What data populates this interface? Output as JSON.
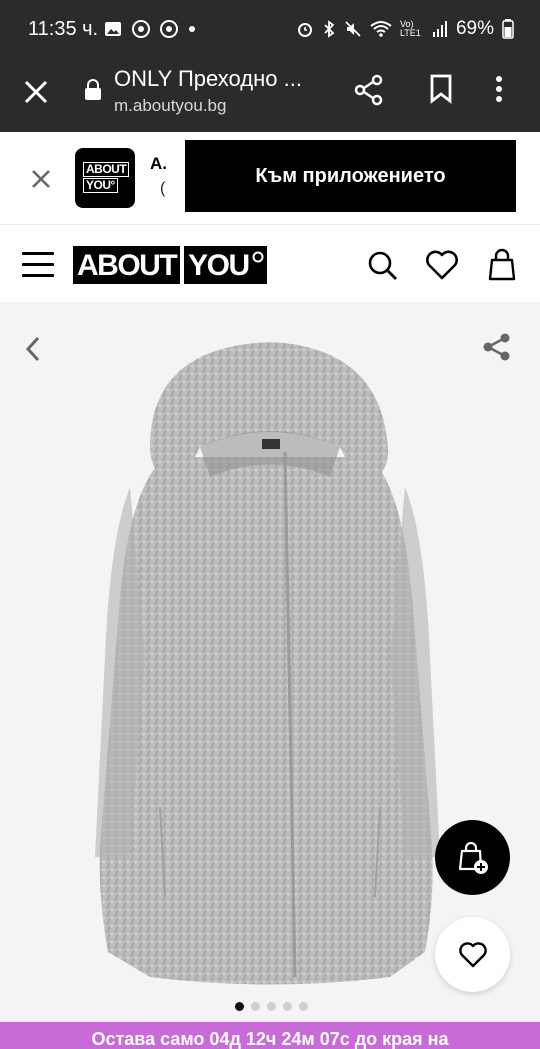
{
  "status_bar": {
    "time": "11:35 ч.",
    "battery": "69%",
    "network_label": "Vo) LTE1"
  },
  "browser": {
    "page_title": "ONLY Преходно ...",
    "domain": "m.aboutyou.bg"
  },
  "app_banner": {
    "logo_lines": [
      "ABOUT",
      "YOU°"
    ],
    "app_name": "A.",
    "app_sub": "(",
    "cta_label": "Към приложението"
  },
  "site_header": {
    "logo_left": "ABOUT",
    "logo_right": "YOU"
  },
  "product": {
    "image_alt": "ONLY grey wool coat with hood",
    "carousel": {
      "total": 5,
      "active": 1
    }
  },
  "promo": {
    "text": "Остава само 04д 12ч 24м 07с до края на"
  },
  "colors": {
    "browser_bar": "#2b2b2b",
    "promo": "#c86ad8",
    "coat": "#b9b9b9"
  }
}
